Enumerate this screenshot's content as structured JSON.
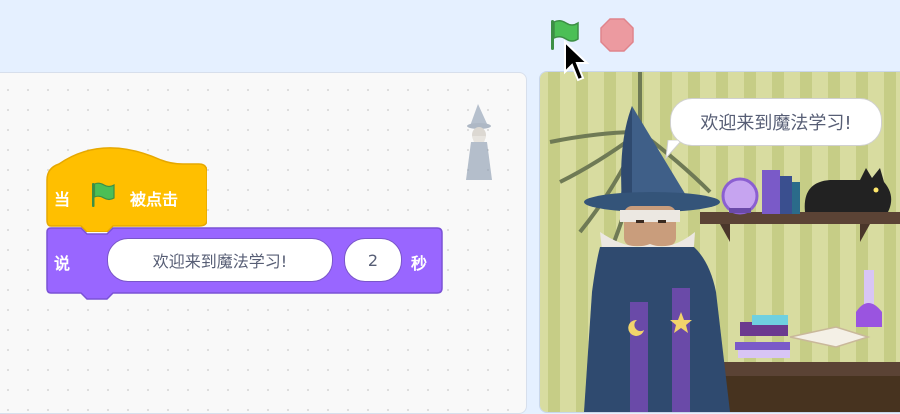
{
  "controls": {
    "green_flag_icon": "green-flag-icon",
    "stop_icon": "stop-icon",
    "colors": {
      "flag": "#4cbf56",
      "stop": "#ec9aa0"
    }
  },
  "code": {
    "hat_block": {
      "prefix": "当",
      "icon": "green-flag-icon",
      "suffix": "被点击",
      "color": "#ffbf00"
    },
    "say_block": {
      "label": "说",
      "message": "欢迎来到魔法学习!",
      "seconds": "2",
      "unit": "秒",
      "color": "#9966ff"
    },
    "sprite_thumbnail_icon": "wizard-sprite-icon"
  },
  "stage": {
    "speech_bubble": "欢迎来到魔法学习!",
    "sprite": "wizard",
    "props": [
      "crystal-ball",
      "books",
      "black-cat",
      "potion-bottle",
      "open-book"
    ]
  }
}
